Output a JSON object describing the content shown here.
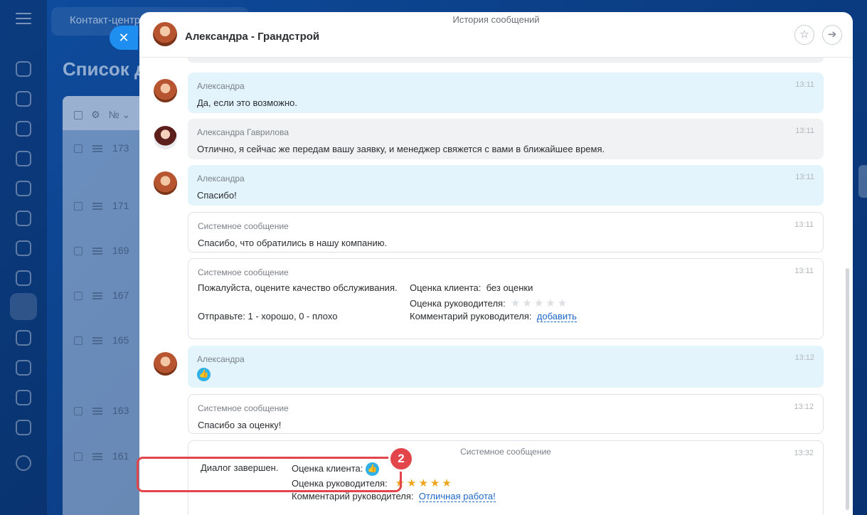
{
  "background": {
    "tab_label": "Контакт-центр",
    "page_title": "Список д",
    "table_header_num": "№",
    "rows": [
      "173",
      "171",
      "169",
      "167",
      "165",
      "163",
      "161"
    ]
  },
  "panel": {
    "top_label": "История сообщений",
    "header_title": "Александра - Грандстрой"
  },
  "messages": [
    {
      "author": "Александра",
      "time": "13:11",
      "text": "Да, если это возможно."
    },
    {
      "author": "Александра Гаврилова",
      "time": "13:11",
      "text": "Отлично, я сейчас же передам вашу заявку, и менеджер свяжется с вами в ближайшее время."
    },
    {
      "author": "Александра",
      "time": "13:11",
      "text": "Спасибо!"
    },
    {
      "author": "Системное сообщение",
      "time": "13:11",
      "text": "Спасибо, что обратились в нашу компанию."
    }
  ],
  "rating_request": {
    "author": "Системное сообщение",
    "time": "13:11",
    "prompt": "Пожалуйста, оцените качество обслуживания.",
    "send_hint": "Отправьте: 1 - хорошо, 0 - плохо",
    "client_rating_label": "Оценка клиента:",
    "client_rating_value": "без оценки",
    "manager_rating_label": "Оценка руководителя:",
    "manager_stars": 0,
    "manager_comment_label": "Комментарий руководителя:",
    "manager_comment_link": "добавить"
  },
  "like_message": {
    "author": "Александра",
    "time": "13:12"
  },
  "thanks_message": {
    "author": "Системное сообщение",
    "time": "13:12",
    "text": "Спасибо за оценку!"
  },
  "final_message": {
    "author": "Системное сообщение",
    "time": "13:32",
    "dialog_status": "Диалог завершен.",
    "client_rating_label": "Оценка клиента:",
    "manager_rating_label": "Оценка руководителя:",
    "manager_stars": 5,
    "manager_comment_label": "Комментарий руководителя:",
    "manager_comment": "Отличная работа!"
  },
  "annotation_badge": "2",
  "colors": {
    "client_bubble": "#e3f4fc",
    "operator_bubble": "#f1f2f4",
    "highlight": "#e2454a",
    "star": "#f0a51e",
    "link": "#1e68c9"
  },
  "icons": {
    "close": "close-icon",
    "like": "thumbs-up-icon",
    "favorite": "star-check-icon",
    "forward": "forward-arrow-icon"
  }
}
